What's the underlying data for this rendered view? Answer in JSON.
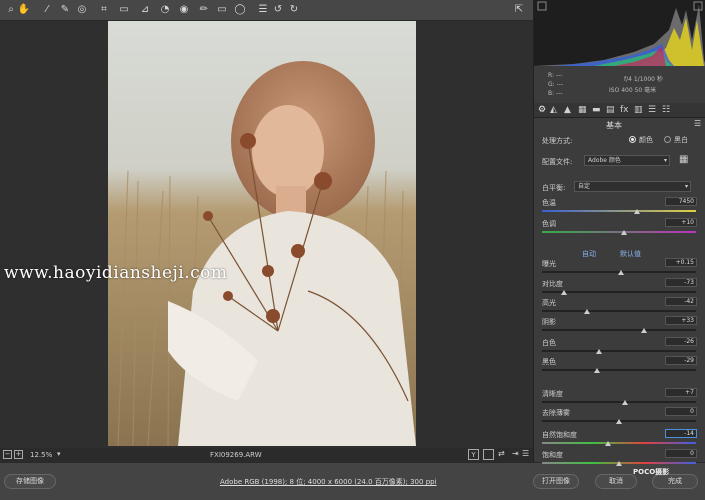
{
  "toolbar": {
    "tools": [
      "zoom-icon",
      "hand-icon",
      "white-balance-icon",
      "color-sampler-icon",
      "target-adjust-icon",
      "crop-icon",
      "straighten-icon",
      "transform-icon",
      "spot-removal-icon",
      "red-eye-icon",
      "adjustment-brush-icon",
      "graduated-filter-icon",
      "radial-filter-icon",
      "presets-icon",
      "rotate-left-icon",
      "rotate-right-icon"
    ]
  },
  "watermark": "www.haoyidiansheji.com",
  "status": {
    "zoom": "12.5%",
    "filename": "FXI09269.ARW"
  },
  "footer": {
    "save_label": "存储图像",
    "workflow": "Adobe RGB (1998); 8 位; 4000 x 6000 (24.0 百万像素); 300 ppi",
    "open_label": "打开图像",
    "cancel_label": "取消",
    "done_label": "完成",
    "brand": "POCO摄影"
  },
  "histogram": {
    "r": "R: ---",
    "g": "G: ---",
    "b": "B: ---",
    "aperture_shutter": "f/4  1/1000 秒",
    "iso_lens": "ISO 400  50 毫米"
  },
  "panel": {
    "section_title": "基本",
    "treatment_label": "处理方式:",
    "treatment_color": "颜色",
    "treatment_bw": "黑白",
    "profile_label": "配置文件:",
    "profile_value": "Adobe 颜色",
    "wb_label": "白平衡:",
    "wb_value": "自定",
    "auto_label": "自动",
    "default_label": "默认值"
  },
  "sliders": [
    {
      "label": "色温",
      "value": "7450",
      "pos": 0.62
    },
    {
      "label": "色调",
      "value": "+10",
      "pos": 0.53
    },
    {
      "label": "曝光",
      "value": "+0.15",
      "pos": 0.51
    },
    {
      "label": "对比度",
      "value": "-73",
      "pos": 0.14
    },
    {
      "label": "高光",
      "value": "-42",
      "pos": 0.29
    },
    {
      "label": "阴影",
      "value": "+33",
      "pos": 0.66
    },
    {
      "label": "白色",
      "value": "-26",
      "pos": 0.37
    },
    {
      "label": "黑色",
      "value": "-29",
      "pos": 0.36
    },
    {
      "label": "清晰度",
      "value": "+7",
      "pos": 0.54
    },
    {
      "label": "去除薄雾",
      "value": "0",
      "pos": 0.5
    },
    {
      "label": "自然饱和度",
      "value": "-14",
      "pos": 0.43
    },
    {
      "label": "饱和度",
      "value": "0",
      "pos": 0.5
    }
  ],
  "colors": {
    "accent": "#4a8fe0",
    "panel_bg": "#3c3c3c",
    "toolbar_bg": "#474747"
  }
}
